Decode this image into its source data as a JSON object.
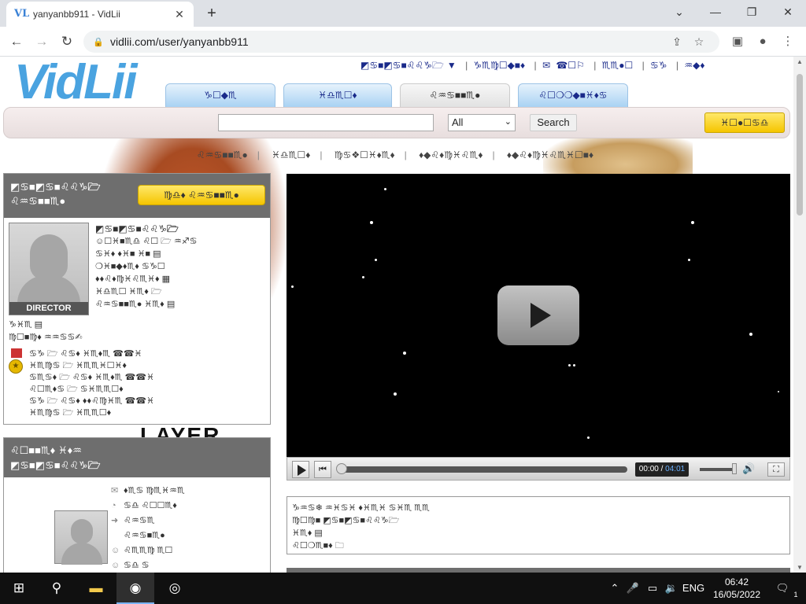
{
  "browser": {
    "tab_title": "yanyanbb911 - VidLii",
    "favicon": "VL",
    "url": "vidlii.com/user/yanyanbb911",
    "icons": [
      "back-arrow-icon",
      "forward-arrow-icon",
      "reload-icon",
      "lock-icon",
      "share-icon",
      "star-icon",
      "side-panel-icon",
      "profile-icon",
      "kebab-menu-icon"
    ]
  },
  "site": {
    "logo_text": "VidLii",
    "top_links": [
      "◩♋■◩♋■♌♌♑🗁",
      "♑♏♍☐◆■♦",
      "☎☐⚐",
      "♏♏●☐",
      "♋♑",
      "♒◆♦"
    ],
    "nav_tabs": [
      "♑☐◆♏",
      "♓♎♏☐♦",
      "♌♒♋■■♏●",
      "♌☐❍❍◆■♓♦♋"
    ],
    "search": {
      "value": "",
      "placeholder": "",
      "select_value": "All",
      "button_label": "Search"
    },
    "upload_label": "♓☐●☐♋♎",
    "subnav": [
      "♌♒♋■■♏●",
      "♓♎♏☐♦",
      "♍♋❖☐♓♦♏♦",
      "♦◆♌♦♍♓♌♏♦",
      "♦◆♌♦♍♓♌♏♓☐■♦"
    ]
  },
  "profile": {
    "header_line1": "◩♋■◩♋■♌♌♑🗁",
    "header_line2": "♌♒♋■■♏●",
    "subscribe_label": "♍♎♦ ♌♒♋■■♏●",
    "role_badge": "DIRECTOR",
    "name": "◩♋■◩♋■♌♌♑🗁",
    "lines": [
      "☺☐♓■♏♎ ♌☐ 🗁 ♒♐♋",
      "♋♓♦ ♦♓■ ♓■ ▤",
      "❍♓■◆♦♏♦ ♋♑☐",
      "♦♦♌♦♍♓♌♏♓♦ ▦",
      "♓♎♏☐ ♓♏♦ 🗁",
      "♌♒♋■■♏● ♓♏♦ ▤"
    ],
    "extra": [
      "♑♓♏ ▤",
      "♍☐■♍♦ ♒♒♋♋✍"
    ],
    "awards": [
      "♋♑ 🗁 ♌♋♦ ♓♏♦♏ ☎☎♓",
      "♓♏♍♋ 🗁 ♓♏♏♓☐♓♦",
      "♋♏♋♦ 🗁 ♌♋♦ ♓♏♦♏ ☎☎♓",
      "♌☐♏♦♋ 🗁 ♋♓♏♏☐♦",
      "♋♑ 🗁 ♌♋♦ ♦♦♌♍♓♏ ☎☎♓",
      "♓♏♍♋ 🗁 ♓♏♏☐♦"
    ]
  },
  "friends": {
    "header_line1": "♌☐■■♏♦ ♓♦♒",
    "header_line2": "◩♋■◩♋■♌♌♑🗁",
    "links": [
      {
        "icon": "mail-icon",
        "label": "♦♏♋ ♍♏♓♒♏"
      },
      {
        "icon": "comment-icon",
        "label": "♋♎ ♌☐☐♏♦"
      },
      {
        "icon": "share-icon",
        "label": "♌♒♋♏"
      },
      {
        "icon": "user-icon",
        "label": "♌♒♋■♏●"
      },
      {
        "icon": "person-icon",
        "label": "♌♏♏♍ ♏☐"
      },
      {
        "icon": "person-icon",
        "label": "♋♎ ♋"
      }
    ],
    "bg_text": "LAYER"
  },
  "player": {
    "current_time": "00:00",
    "duration": "04:01",
    "progress": 0,
    "volume": 0.9
  },
  "video_info": {
    "title": "♑♒♋❄ ♒♓♋♓ ♦♓♏♓ ♋♓♏ ♏♏",
    "lines": [
      "♍☐♍■ ◩♋■◩♋■♌♌♑🗁",
      "♓♏♦ ▤",
      "♌☐❍♏■♦ 🗀"
    ]
  },
  "taskbar": {
    "lang": "ENG",
    "time": "06:42",
    "date": "16/05/2022",
    "notifications": "1"
  }
}
